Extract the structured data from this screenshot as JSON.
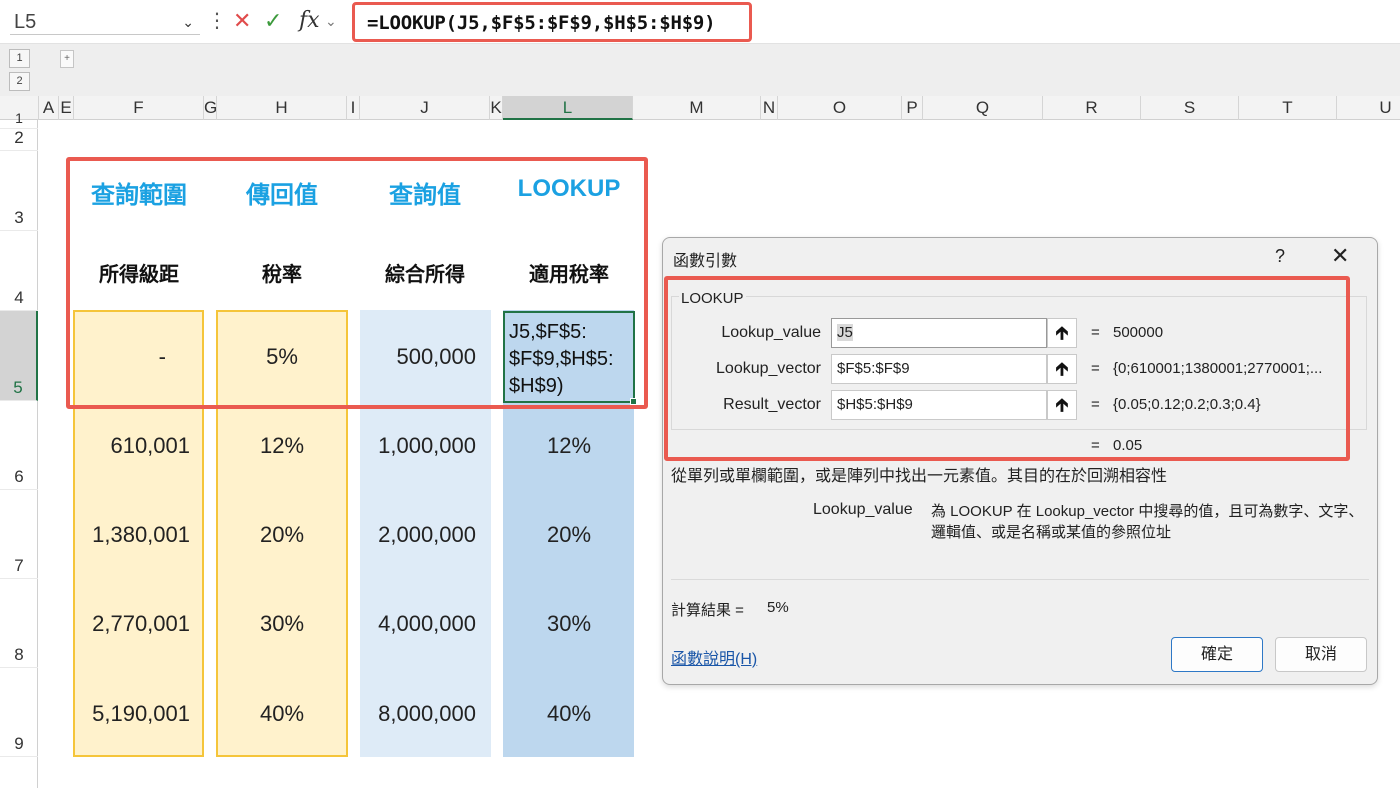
{
  "formula_bar": {
    "name_box": "L5",
    "formula": "=LOOKUP(J5,$F$5:$F$9,$H$5:$H$9)",
    "icons": [
      "more-icon",
      "cancel-icon",
      "enter-icon",
      "function-icon"
    ]
  },
  "outline": {
    "levels": [
      "1",
      "2"
    ],
    "mini": "+"
  },
  "columns": [
    "A",
    "E",
    "F",
    "G",
    "H",
    "I",
    "J",
    "K",
    "L",
    "M",
    "N",
    "O",
    "P",
    "Q",
    "R",
    "S",
    "T",
    "U"
  ],
  "rows": [
    "1",
    "2",
    "3",
    "4",
    "5",
    "6",
    "7",
    "8",
    "9"
  ],
  "sheet": {
    "headers_blue": [
      "查詢範圍",
      "傳回值",
      "查詢值",
      "LOOKUP"
    ],
    "headers_black": [
      "所得級距",
      "稅率",
      "綜合所得",
      "適用稅率"
    ],
    "col_f": [
      "-",
      "610,001",
      "1,380,001",
      "2,770,001",
      "5,190,001"
    ],
    "col_h": [
      "5%",
      "12%",
      "20%",
      "30%",
      "40%"
    ],
    "col_j": [
      "500,000",
      "1,000,000",
      "2,000,000",
      "4,000,000",
      "8,000,000"
    ],
    "col_l": [
      "",
      "12%",
      "20%",
      "30%",
      "40%"
    ],
    "active_cell_text": "J5,$F$5:\n$F$9,$H$5:\n$H$9)"
  },
  "dialog": {
    "title": "函數引數",
    "help_glyph": "?",
    "close_glyph": "✕",
    "function_name": "LOOKUP",
    "args": [
      {
        "label": "Lookup_value",
        "input": "J5",
        "eq": "=",
        "value": "500000"
      },
      {
        "label": "Lookup_vector",
        "input": "$F$5:$F$9",
        "eq": "=",
        "value": "{0;610001;1380001;2770001;..."
      },
      {
        "label": "Result_vector",
        "input": "$H$5:$H$9",
        "eq": "=",
        "value": "{0.05;0.12;0.2;0.3;0.4}"
      }
    ],
    "result_eq": "=",
    "result_preview": "0.05",
    "description": "從單列或單欄範圍，或是陣列中找出一元素值。其目的在於回溯相容性",
    "arg_help_name": "Lookup_value",
    "arg_help_text": "為 LOOKUP 在 Lookup_vector 中搜尋的值，且可為數字、文字、邏輯值、或是名稱或某值的參照位址",
    "result_label": "計算結果 =",
    "result_value": "5%",
    "help_link": "函數說明(H)",
    "ok": "確定",
    "cancel": "取消"
  },
  "colors": {
    "highlight_red": "#ea5a50",
    "header_blue": "#1ba1e2",
    "yellow_fill": "#fff2cc",
    "yellow_border": "#f5c53a",
    "blue_fill_light": "#deebf7",
    "blue_fill": "#bdd7ee",
    "excel_green": "#217346"
  }
}
